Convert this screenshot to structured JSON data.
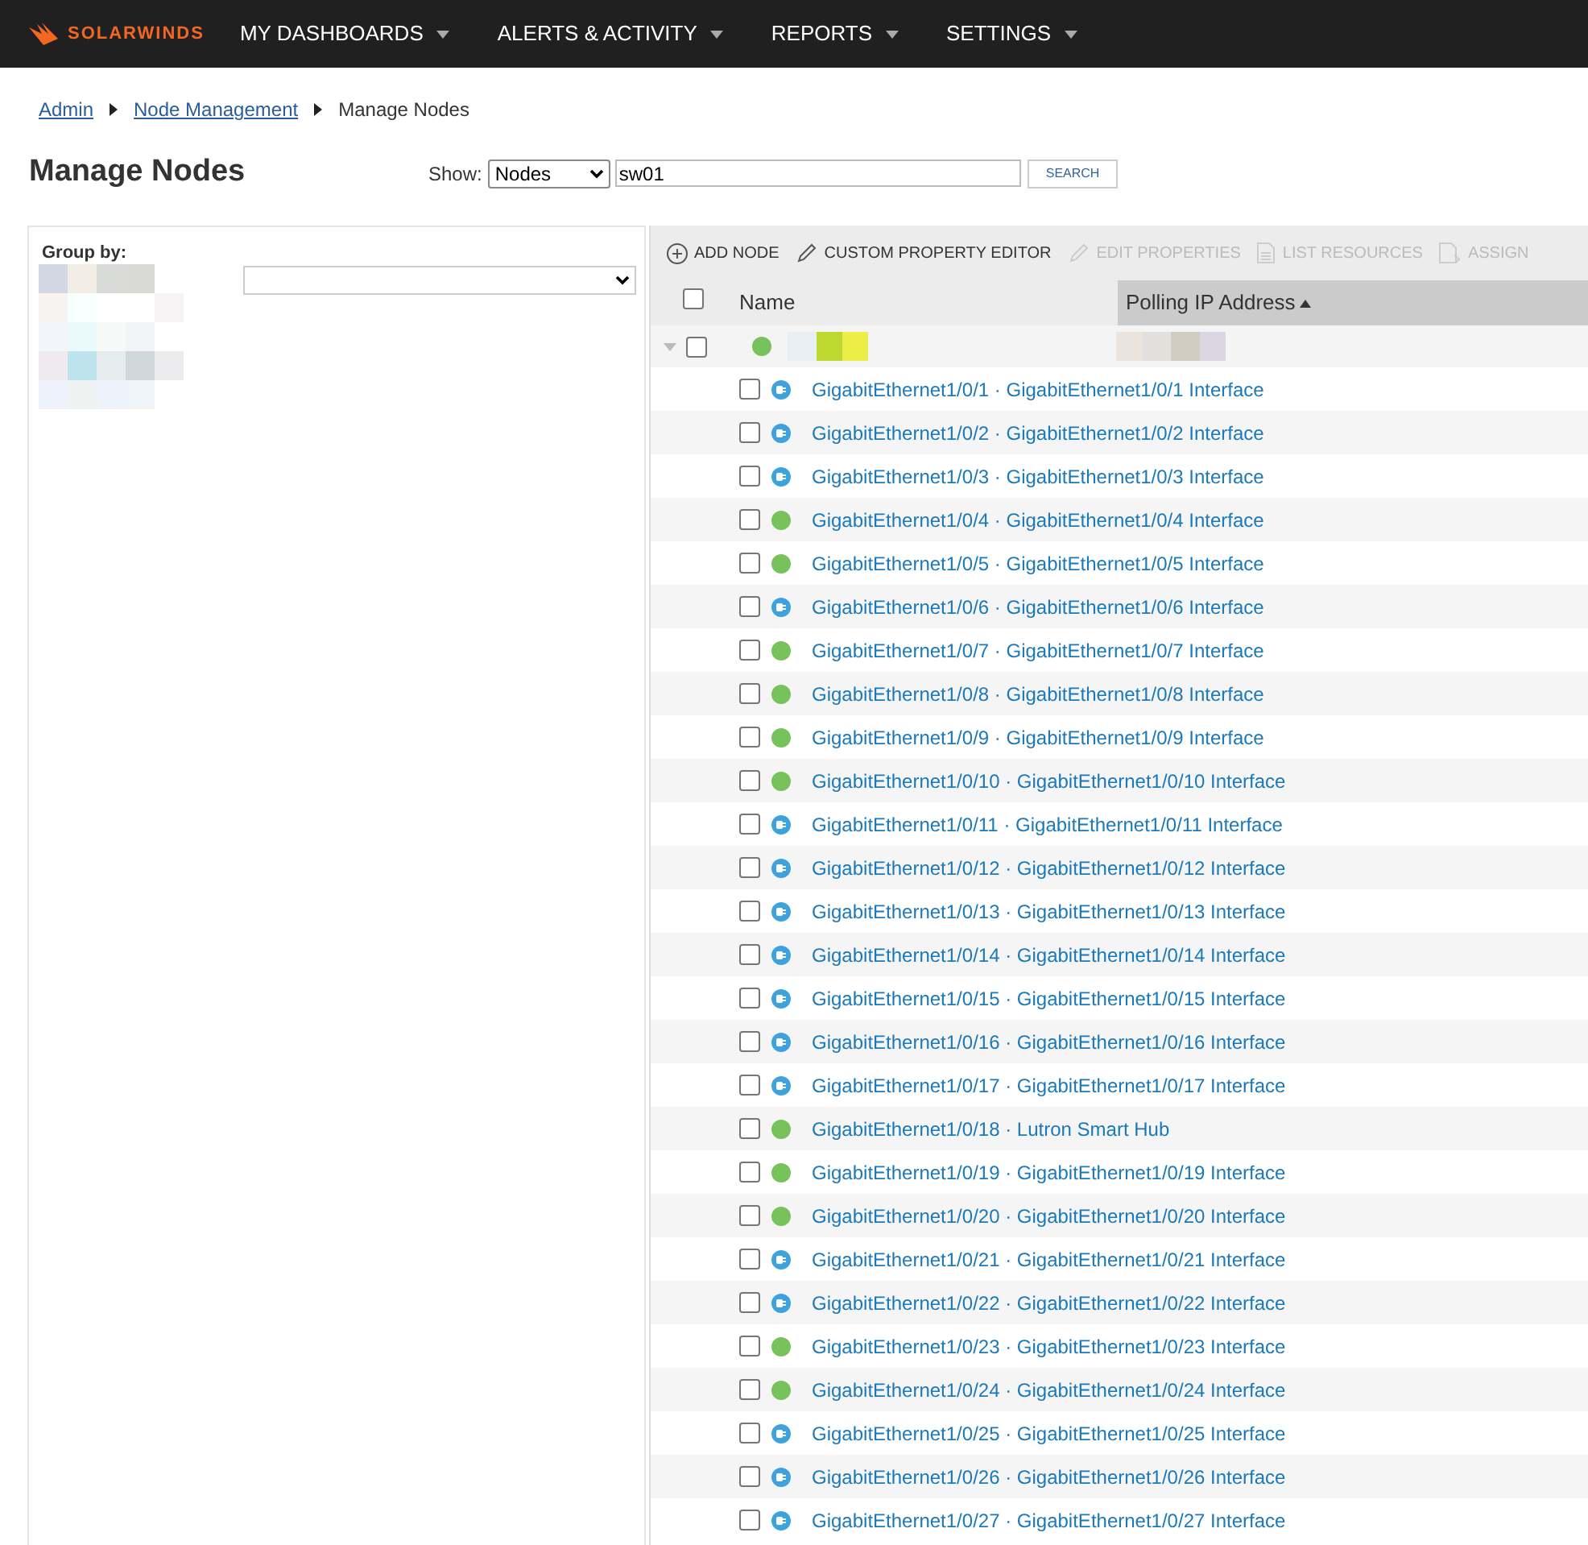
{
  "header": {
    "brand": "SOLARWINDS",
    "menu": [
      {
        "label": "MY DASHBOARDS"
      },
      {
        "label": "ALERTS & ACTIVITY"
      },
      {
        "label": "REPORTS"
      },
      {
        "label": "SETTINGS"
      }
    ]
  },
  "breadcrumb": [
    {
      "label": "Admin",
      "kind": "link"
    },
    {
      "label": "Node Management",
      "kind": "link"
    },
    {
      "label": "Manage Nodes",
      "kind": "current"
    }
  ],
  "page_title": "Manage Nodes",
  "show": {
    "label": "Show:",
    "value": "Nodes",
    "search_value": "sw01",
    "button": "SEARCH"
  },
  "group_by": {
    "label": "Group by:"
  },
  "toolbar": [
    {
      "label": "ADD NODE",
      "kind": "add",
      "disabled": false
    },
    {
      "label": "CUSTOM PROPERTY EDITOR",
      "kind": "edit",
      "disabled": false
    },
    {
      "label": "EDIT PROPERTIES",
      "kind": "edit",
      "disabled": true
    },
    {
      "label": "LIST RESOURCES",
      "kind": "list",
      "disabled": true
    },
    {
      "label": "ASSIGN",
      "kind": "assign",
      "disabled": true
    }
  ],
  "table": {
    "columns": [
      {
        "label": "Name",
        "sorted": false
      },
      {
        "label": "Polling IP Address",
        "sorted": true
      }
    ],
    "select_all": {
      "checked": false
    },
    "node": {
      "up": true,
      "expanded": true,
      "checked": false
    },
    "rows": [
      {
        "name": "GigabitEthernet1/0/1 · GigabitEthernet1/0/1 Interface",
        "kind": "unplugged",
        "checked": false
      },
      {
        "name": "GigabitEthernet1/0/2 · GigabitEthernet1/0/2 Interface",
        "kind": "unplugged",
        "checked": false
      },
      {
        "name": "GigabitEthernet1/0/3 · GigabitEthernet1/0/3 Interface",
        "kind": "unplugged",
        "checked": false
      },
      {
        "name": "GigabitEthernet1/0/4 · GigabitEthernet1/0/4 Interface",
        "kind": "up",
        "checked": false
      },
      {
        "name": "GigabitEthernet1/0/5 · GigabitEthernet1/0/5 Interface",
        "kind": "up",
        "checked": false
      },
      {
        "name": "GigabitEthernet1/0/6 · GigabitEthernet1/0/6 Interface",
        "kind": "unplugged",
        "checked": false
      },
      {
        "name": "GigabitEthernet1/0/7 · GigabitEthernet1/0/7 Interface",
        "kind": "up",
        "checked": false
      },
      {
        "name": "GigabitEthernet1/0/8 · GigabitEthernet1/0/8 Interface",
        "kind": "up",
        "checked": false
      },
      {
        "name": "GigabitEthernet1/0/9 · GigabitEthernet1/0/9 Interface",
        "kind": "up",
        "checked": false
      },
      {
        "name": "GigabitEthernet1/0/10 · GigabitEthernet1/0/10 Interface",
        "kind": "up",
        "checked": false
      },
      {
        "name": "GigabitEthernet1/0/11 · GigabitEthernet1/0/11 Interface",
        "kind": "unplugged",
        "checked": false
      },
      {
        "name": "GigabitEthernet1/0/12 · GigabitEthernet1/0/12 Interface",
        "kind": "unplugged",
        "checked": false
      },
      {
        "name": "GigabitEthernet1/0/13 · GigabitEthernet1/0/13 Interface",
        "kind": "unplugged",
        "checked": false
      },
      {
        "name": "GigabitEthernet1/0/14 · GigabitEthernet1/0/14 Interface",
        "kind": "unplugged",
        "checked": false
      },
      {
        "name": "GigabitEthernet1/0/15 · GigabitEthernet1/0/15 Interface",
        "kind": "unplugged",
        "checked": false
      },
      {
        "name": "GigabitEthernet1/0/16 · GigabitEthernet1/0/16 Interface",
        "kind": "unplugged",
        "checked": false
      },
      {
        "name": "GigabitEthernet1/0/17 · GigabitEthernet1/0/17 Interface",
        "kind": "unplugged",
        "checked": false
      },
      {
        "name": "GigabitEthernet1/0/18 · Lutron Smart Hub",
        "kind": "up",
        "checked": false
      },
      {
        "name": "GigabitEthernet1/0/19 · GigabitEthernet1/0/19 Interface",
        "kind": "up",
        "checked": false
      },
      {
        "name": "GigabitEthernet1/0/20 · GigabitEthernet1/0/20 Interface",
        "kind": "up",
        "checked": false
      },
      {
        "name": "GigabitEthernet1/0/21 · GigabitEthernet1/0/21 Interface",
        "kind": "unplugged",
        "checked": false
      },
      {
        "name": "GigabitEthernet1/0/22 · GigabitEthernet1/0/22 Interface",
        "kind": "unplugged",
        "checked": false
      },
      {
        "name": "GigabitEthernet1/0/23 · GigabitEthernet1/0/23 Interface",
        "kind": "up",
        "checked": false
      },
      {
        "name": "GigabitEthernet1/0/24 · GigabitEthernet1/0/24 Interface",
        "kind": "up",
        "checked": false
      },
      {
        "name": "GigabitEthernet1/0/25 · GigabitEthernet1/0/25 Interface",
        "kind": "unplugged",
        "checked": false
      },
      {
        "name": "GigabitEthernet1/0/26 · GigabitEthernet1/0/26 Interface",
        "kind": "unplugged",
        "checked": false
      },
      {
        "name": "GigabitEthernet1/0/27 · GigabitEthernet1/0/27 Interface",
        "kind": "unplugged",
        "checked": false
      }
    ]
  }
}
